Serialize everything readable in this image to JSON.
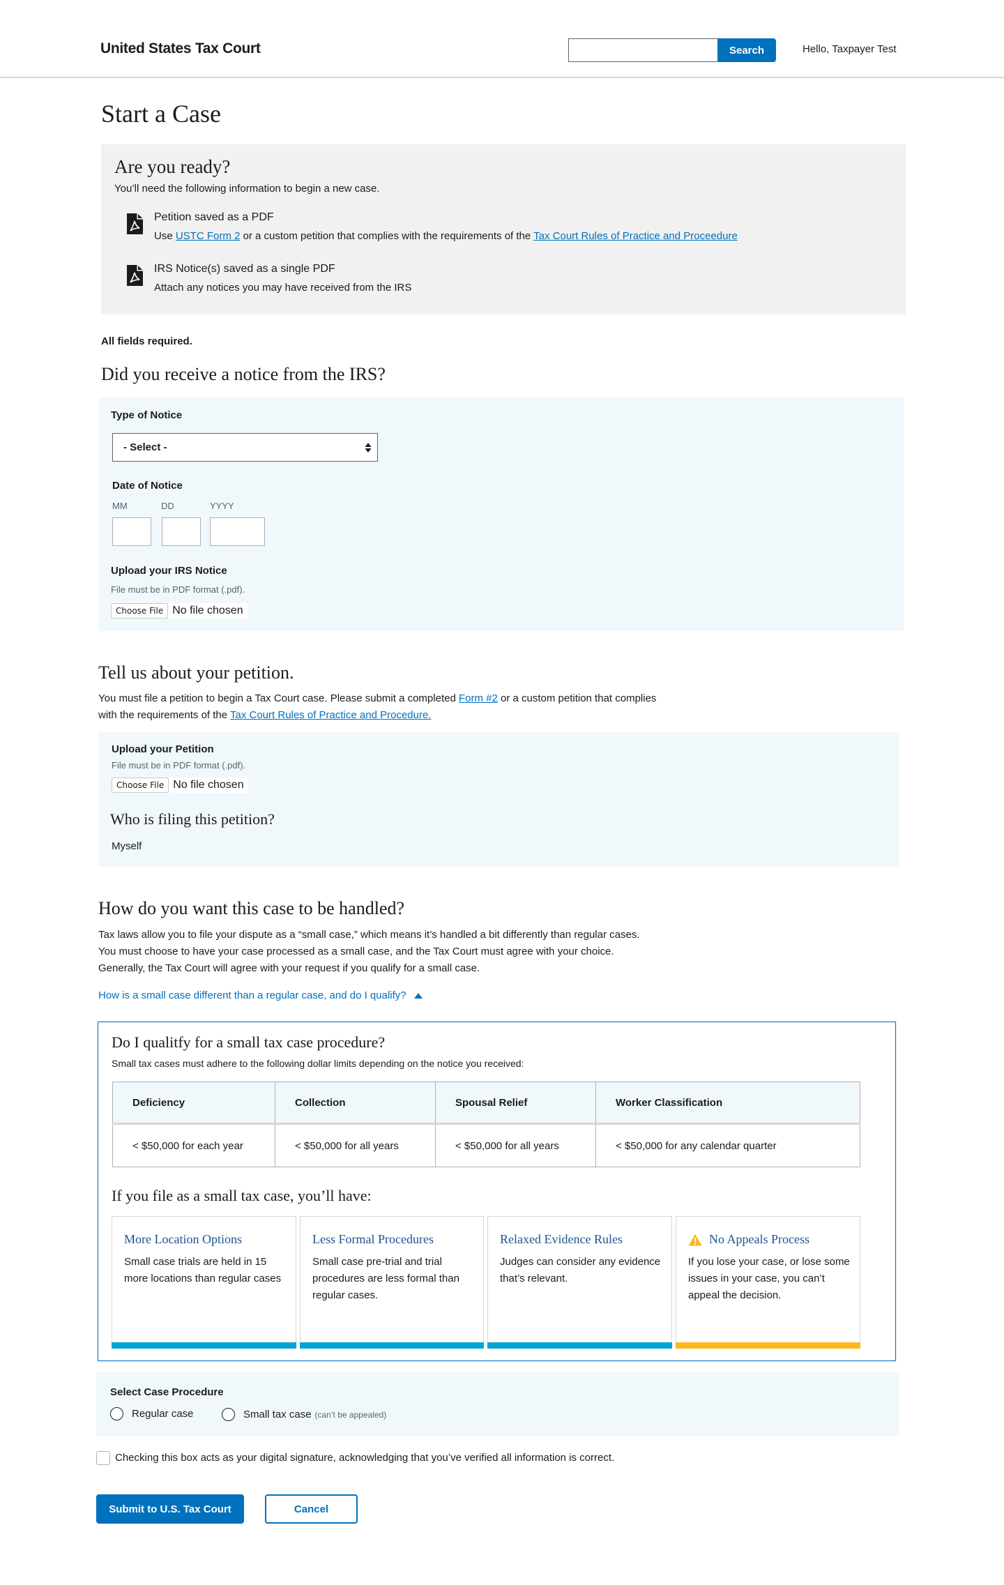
{
  "header": {
    "logo": "United States Tax Court",
    "search_placeholder": "",
    "search_button": "Search",
    "greeting": "Hello, Taxpayer Test"
  },
  "page_title": "Start a Case",
  "ready": {
    "heading": "Are you ready?",
    "intro": "You’ll need the following information to begin a new case.",
    "items": [
      {
        "icon": "pdf-file-icon",
        "title": "Petition saved as a PDF",
        "desc_prefix": "Use ",
        "link1": "USTC Form 2",
        "desc_middle": " or a custom petition that complies with the requirements of the ",
        "link2": "Tax Court Rules of Practice and Proceedure"
      },
      {
        "icon": "pdf-file-icon",
        "title": "IRS Notice(s) saved as a single PDF",
        "desc": "Attach any notices you may have received from the IRS"
      }
    ]
  },
  "all_fields_required": "All fields required.",
  "notice_section": {
    "heading": "Did you receive a notice from the IRS?",
    "type_label": "Type of Notice",
    "type_value": "- Select -",
    "date_label": "Date of Notice",
    "date_parts": [
      "MM",
      "DD",
      "YYYY"
    ],
    "upload_label": "Upload your IRS Notice",
    "upload_hint": "File must be in PDF format (.pdf).",
    "choose_file": "Choose File",
    "file_status": "No file chosen"
  },
  "petition_section": {
    "heading": "Tell us about your petition.",
    "text_line1_prefix": "You must file a petition to begin a Tax Court case. Please submit a completed ",
    "form_link": "Form #2",
    "text_line1_suffix": " or a custom petition that complies",
    "text_line2_prefix": "with the requirements of the ",
    "rules_link": "Tax Court Rules of Practice and Procedure.",
    "upload_label": "Upload your Petition",
    "upload_hint": "File must be in PDF format (.pdf).",
    "choose_file": "Choose File",
    "file_status": "No file chosen",
    "filer_heading": "Who is filing this petition?",
    "filer_value": "Myself"
  },
  "handling_section": {
    "heading": "How do you want this case to be handled?",
    "lines": [
      "Tax laws allow you to file your dispute as a “small case,” which means it’s handled a bit differently than regular cases.",
      "You must choose to have your case processed as a small case, and the Tax Court must agree with your choice.",
      "Generally, the Tax Court will agree with your request if you qualify for a small case."
    ],
    "toggle_link": "How is a small case different than a regular case, and do I qualify?"
  },
  "qualify_box": {
    "heading": "Do I qualitfy for a small tax case procedure?",
    "sub": "Small tax cases must adhere to the following dollar limits depending on the notice you received:",
    "table": {
      "headers": [
        "Deficiency",
        "Collection",
        "Spousal Relief",
        "Worker Classification"
      ],
      "rows": [
        [
          "< $50,000 for each year",
          "< $50,000 for all years",
          "< $50,000 for all years",
          "< $50,000 for any calendar quarter"
        ]
      ]
    },
    "cards_heading": "If you file as a small tax case, you’ll have:",
    "cards": [
      {
        "title": "More Location Options",
        "desc": "Small case trials are held in 15 more locations than regular cases",
        "accent": "#02a4d3"
      },
      {
        "title": "Less Formal Procedures",
        "desc": "Small case pre-trial and trial procedures are less formal than regular cases.",
        "accent": "#02a4d3"
      },
      {
        "title": "Relaxed Evidence Rules",
        "desc": "Judges can consider any evidence that’s relevant.",
        "accent": "#02a4d3"
      },
      {
        "title": "No Appeals Process",
        "desc": "If you lose your case, or lose some issues in your case, you can’t appeal the decision.",
        "accent": "#fdb81e",
        "icon": "warning-icon"
      }
    ]
  },
  "procedure": {
    "label": "Select Case Procedure",
    "options": [
      {
        "label": "Regular case",
        "note": "",
        "selected": false
      },
      {
        "label": "Small tax case",
        "note": "(can’t be appealed)",
        "selected": false
      }
    ]
  },
  "signature": {
    "checked": false,
    "text": "Checking this box acts as your digital signature, acknowledging that you’ve verified all information is correct."
  },
  "actions": {
    "submit": "Submit to U.S. Tax Court",
    "cancel": "Cancel"
  },
  "colors": {
    "primary": "#0071bc",
    "panel_bg": "#f1f8fc",
    "gray_bg": "#f1f1f1",
    "card_title": "#205493",
    "accent_cyan": "#02a4d3",
    "accent_gold": "#fdb81e"
  }
}
